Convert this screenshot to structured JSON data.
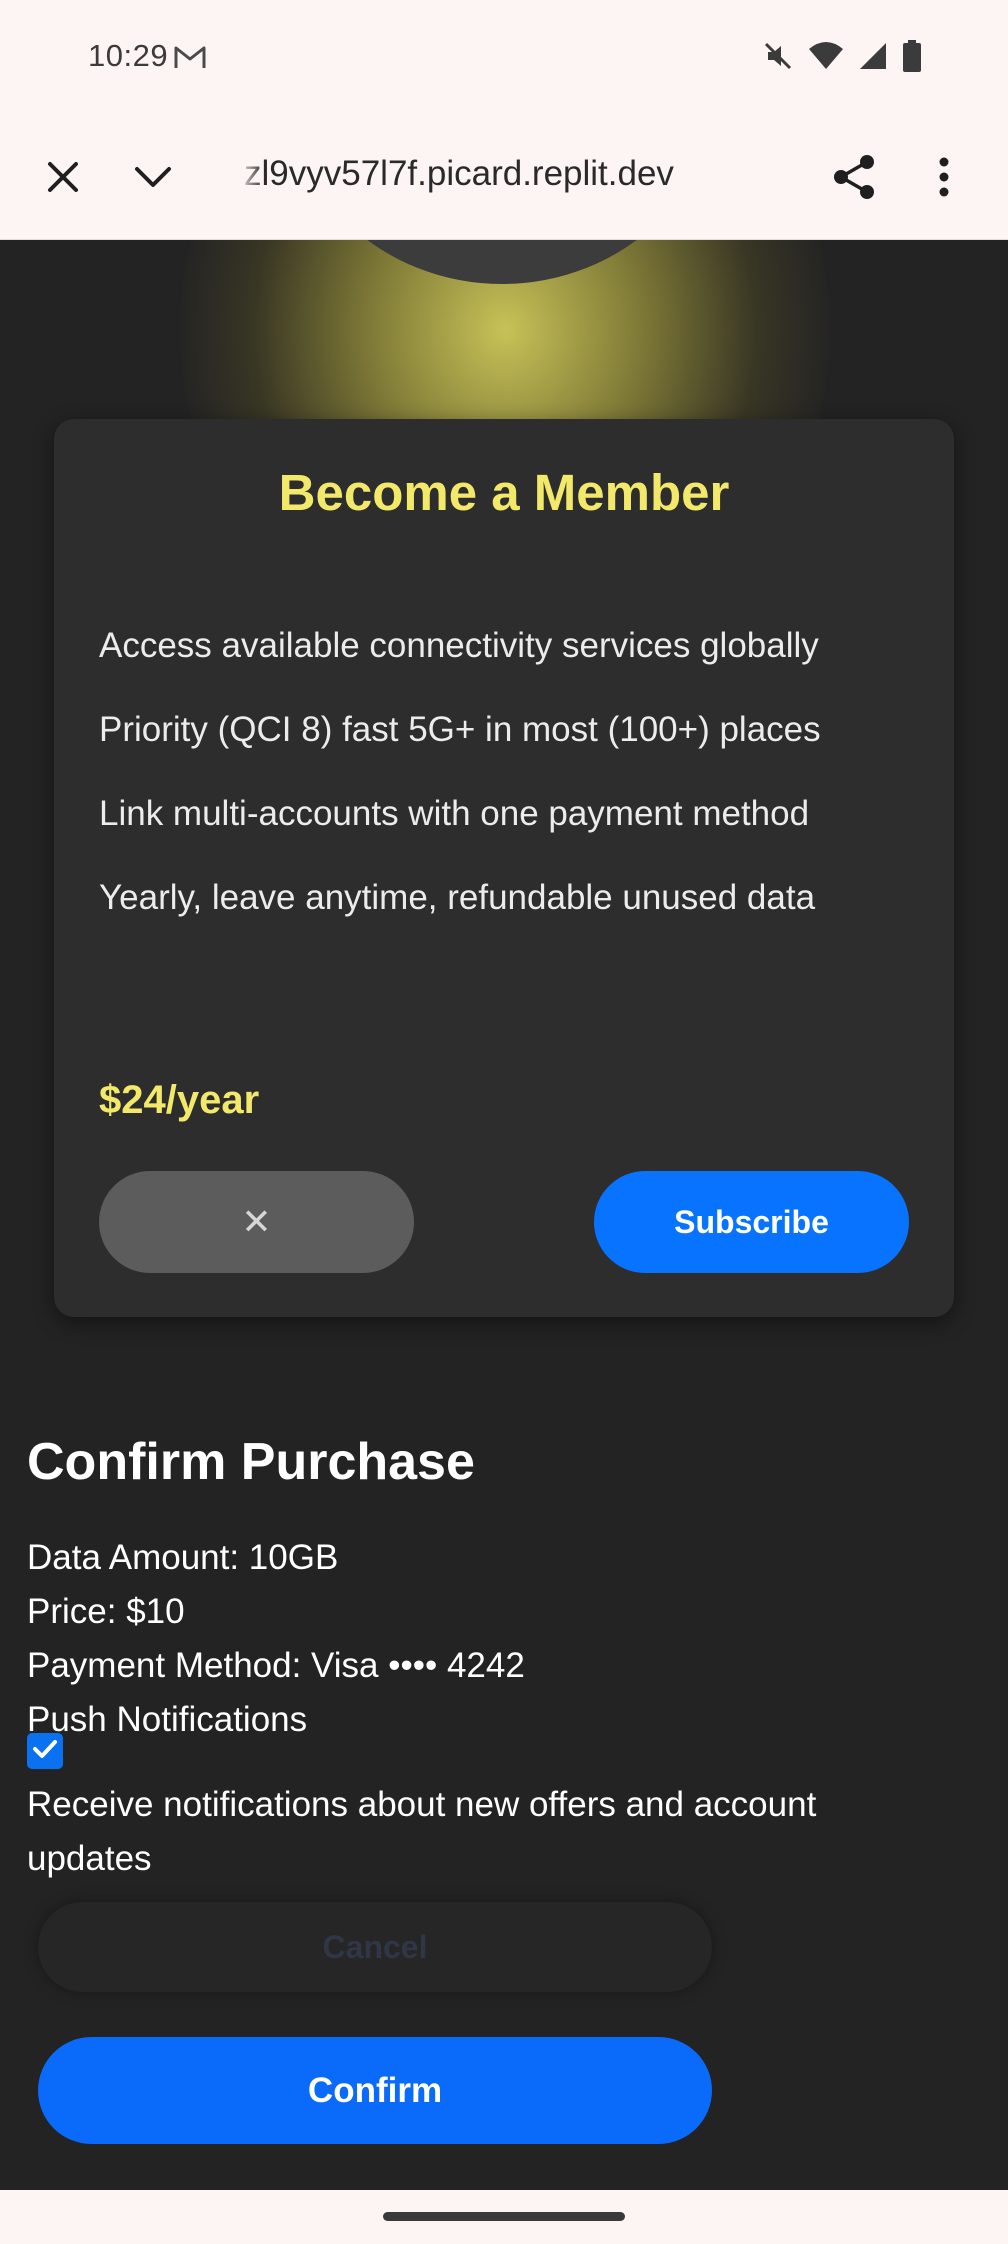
{
  "status_bar": {
    "time": "10:29",
    "icons": [
      "gmail-icon",
      "mute-icon",
      "wifi-icon",
      "signal-icon",
      "battery-icon"
    ]
  },
  "browser": {
    "url": "zl9vyv57l7f.picard.replit.dev",
    "icons": [
      "close-icon",
      "chevron-down-icon",
      "share-icon",
      "more-vert-icon"
    ]
  },
  "membership_card": {
    "title": "Become a Member",
    "features": [
      "Access available connectivity services globally",
      "Priority (QCI 8) fast 5G+ in most (100+) places",
      "Link multi-accounts with one payment method",
      "Yearly, leave anytime, refundable unused data"
    ],
    "price": "$24/year",
    "dismiss_label": "✕",
    "subscribe_label": "Subscribe"
  },
  "purchase": {
    "title": "Confirm Purchase",
    "data_amount": "Data Amount: 10GB",
    "price": "Price: $10",
    "payment_method": "Payment Method: Visa •••• 4242",
    "push_label": "Push Notifications",
    "push_checked": true,
    "push_description": "Receive notifications about new offers and account updates",
    "cancel_label": "Cancel",
    "confirm_label": "Confirm"
  },
  "colors": {
    "accent_yellow": "#f2e86a",
    "primary_blue": "#0873ff",
    "background": "#232323",
    "card": "#2d2d2d",
    "chrome": "#fdf5f3"
  }
}
